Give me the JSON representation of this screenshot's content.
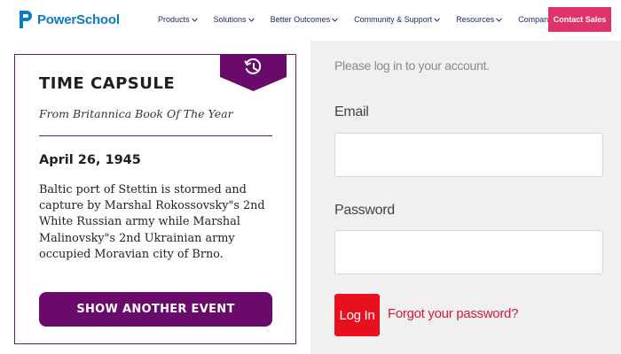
{
  "header": {
    "logo_text": "PowerSchool",
    "nav": [
      {
        "label": "Products"
      },
      {
        "label": "Solutions"
      },
      {
        "label": "Better Outcomes"
      },
      {
        "label": "Community & Support"
      },
      {
        "label": "Resources"
      },
      {
        "label": "Company"
      }
    ],
    "contact_label": "Contact Sales"
  },
  "card": {
    "badge_icon": "history-clock-icon",
    "title": "TIME CAPSULE",
    "subtitle": "From Britannica Book Of The Year",
    "date": "April 26, 1945",
    "event_text": "Baltic port of Stettin is stormed and capture by Marshal Rokossovsky\"s 2nd White Russian army while Marshal Malinovsky\"s 2nd Ukrainian army occupied Moravian city of Brno.",
    "button_label": "SHOW ANOTHER EVENT"
  },
  "login": {
    "prompt": "Please log in to your account.",
    "email_label": "Email",
    "email_value": "",
    "password_label": "Password",
    "password_value": "",
    "login_label": "Log In",
    "forgot_label": "Forgot your password?"
  },
  "colors": {
    "brand_blue": "#0a7dc2",
    "nav_text": "#1b2a6b",
    "contact_pink": "#e0336a",
    "card_purple": "#6a0a6a",
    "login_red": "#e8101e",
    "link_red": "#d31b3b",
    "panel_gray": "#f0f0f0"
  }
}
